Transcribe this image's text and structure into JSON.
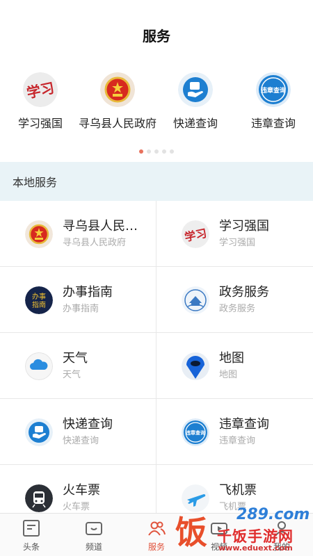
{
  "header": {
    "title": "服务"
  },
  "quick_services": [
    {
      "label": "学习强国",
      "icon": "xuexi-qiangguo-icon"
    },
    {
      "label": "寻乌县人民政府",
      "icon": "national-emblem-icon"
    },
    {
      "label": "快递查询",
      "icon": "express-query-icon"
    },
    {
      "label": "违章查询",
      "icon": "traffic-violation-icon",
      "icon_text": "违章查询"
    }
  ],
  "carousel": {
    "page_count": 5,
    "active_index": 0
  },
  "local_section": {
    "title": "本地服务"
  },
  "local_services": [
    {
      "name": "寻乌县人民…",
      "sub": "寻乌县人民政府",
      "icon": "national-emblem-icon"
    },
    {
      "name": "学习强国",
      "sub": "学习强国",
      "icon": "xuexi-qiangguo-icon"
    },
    {
      "name": "办事指南",
      "sub": "办事指南",
      "icon": "service-guide-icon",
      "icon_text": [
        "办事",
        "指南"
      ]
    },
    {
      "name": "政务服务",
      "sub": "政务服务",
      "icon": "government-service-icon"
    },
    {
      "name": "天气",
      "sub": "天气",
      "icon": "weather-cloud-icon"
    },
    {
      "name": "地图",
      "sub": "地图",
      "icon": "map-pin-icon"
    },
    {
      "name": "快递查询",
      "sub": "快递查询",
      "icon": "express-query-icon"
    },
    {
      "name": "违章查询",
      "sub": "违章查询",
      "icon": "traffic-violation-icon",
      "icon_text": "违章查询"
    },
    {
      "name": "火车票",
      "sub": "火车票",
      "icon": "train-icon"
    },
    {
      "name": "飞机票",
      "sub": "飞机票",
      "icon": "airplane-icon"
    }
  ],
  "tabbar": [
    {
      "label": "头条",
      "icon": "headline-doc-icon",
      "active": false
    },
    {
      "label": "频道",
      "icon": "channel-tv-icon",
      "active": false
    },
    {
      "label": "服务",
      "icon": "service-people-icon",
      "active": true
    },
    {
      "label": "视频",
      "icon": "video-icon",
      "active": false
    },
    {
      "label": "我的",
      "icon": "profile-icon",
      "active": false
    }
  ],
  "watermark": {
    "mark": "饭",
    "number": "289.com",
    "title": "千饭手游网",
    "url": "www.eduext.com"
  },
  "colors": {
    "accent": "#e0533c",
    "section_bg": "#e9f3f7",
    "blue": "#1d7fd1"
  }
}
